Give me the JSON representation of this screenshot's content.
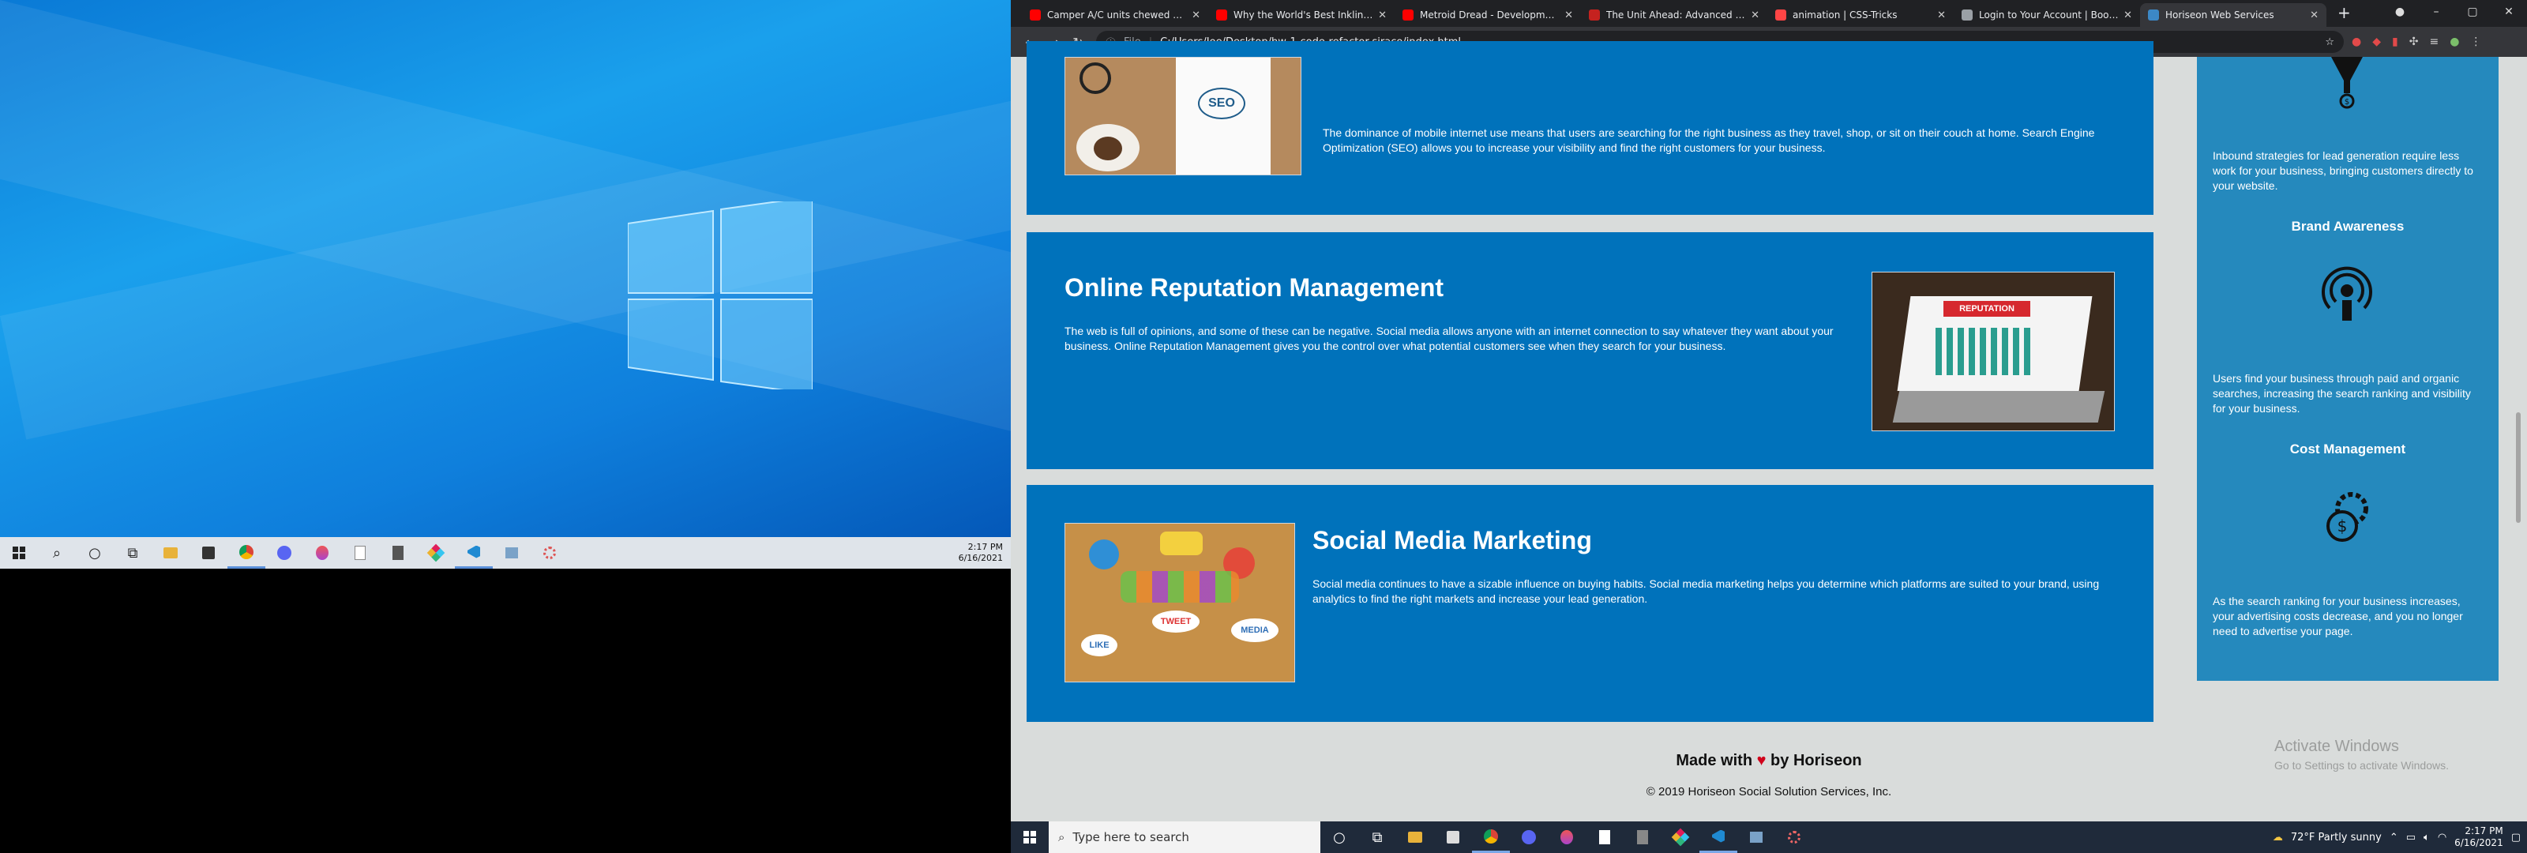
{
  "left_screen": {
    "taskbar_icons": [
      "windows-icon",
      "search-icon",
      "cortana-icon",
      "task-view-icon",
      "file-explorer-icon",
      "store-icon",
      "chrome-icon",
      "discord-icon",
      "app-icon",
      "notepad-icon",
      "calculator-icon",
      "slack-icon",
      "vscode-icon",
      "app-icon",
      "app-icon"
    ],
    "clock_time": "2:17 PM",
    "clock_date": "6/16/2021"
  },
  "browser": {
    "tabs": [
      {
        "title": "Camper A/C units chewed off by",
        "favicon_color": "#ff0000"
      },
      {
        "title": "Why the World's Best Inkling Pla",
        "favicon_color": "#ff0000"
      },
      {
        "title": "Metroid Dread - Development Hi",
        "favicon_color": "#ff0000"
      },
      {
        "title": "The Unit Ahead: Advanced CSS",
        "favicon_color": "#c5221f"
      },
      {
        "title": "animation | CSS-Tricks",
        "favicon_color": "#ff4545"
      },
      {
        "title": "Login to Your Account | Bootcam",
        "favicon_color": "#9aa0a6"
      },
      {
        "title": "Horiseon Web Services",
        "favicon_color": "#3c88c6"
      }
    ],
    "active_tab": 6,
    "address_prefix": "File",
    "url": "C:/Users/Joe/Desktop/hw-1-code-refactor-siraco/index.html"
  },
  "page": {
    "seo_text": "The dominance of mobile internet use means that users are searching for the right business as they travel, shop, or sit on their couch at home. Search Engine Optimization (SEO) allows you to increase your visibility and find the right customers for your business.",
    "reputation": {
      "title": "Online Reputation Management",
      "text": "The web is full of opinions, and some of these can be negative. Social media allows anyone with an internet connection to say whatever they want about your business. Online Reputation Management gives you the control over what potential customers see when they search for your business.",
      "image_word": "REPUTATION"
    },
    "social": {
      "title": "Social Media Marketing",
      "text": "Social media continues to have a sizable influence on buying habits. Social media marketing helps you determine which platforms are suited to your brand, using analytics to find the right markets and increase your lead generation.",
      "image_words": [
        "TWEET",
        "LIKE",
        "MEDIA"
      ]
    },
    "aside": {
      "lead_text": "Inbound strategies for lead generation require less work for your business, bringing customers directly to your website.",
      "brand_title": "Brand Awareness",
      "brand_text": "Users find your business through paid and organic searches, increasing the search ranking and visibility for your business.",
      "cost_title": "Cost Management",
      "cost_text": "As the search ranking for your business increases, your advertising costs decrease, and you no longer need to advertise your page."
    },
    "footer": {
      "made_with": "Made with",
      "by": "by Horiseon",
      "copyright": "© 2019 Horiseon Social Solution Services, Inc."
    },
    "activate": {
      "title": "Activate Windows",
      "subtitle": "Go to Settings to activate Windows."
    },
    "seo_image_words": [
      "SEO"
    ]
  },
  "right_taskbar": {
    "search_placeholder": "Type here to search",
    "weather": "72°F  Partly sunny",
    "clock_time": "2:17 PM",
    "clock_date": "6/16/2021"
  },
  "colors": {
    "card_blue": "#0072bb",
    "aside_blue": "#2589bd",
    "heart": "#d0021b"
  }
}
